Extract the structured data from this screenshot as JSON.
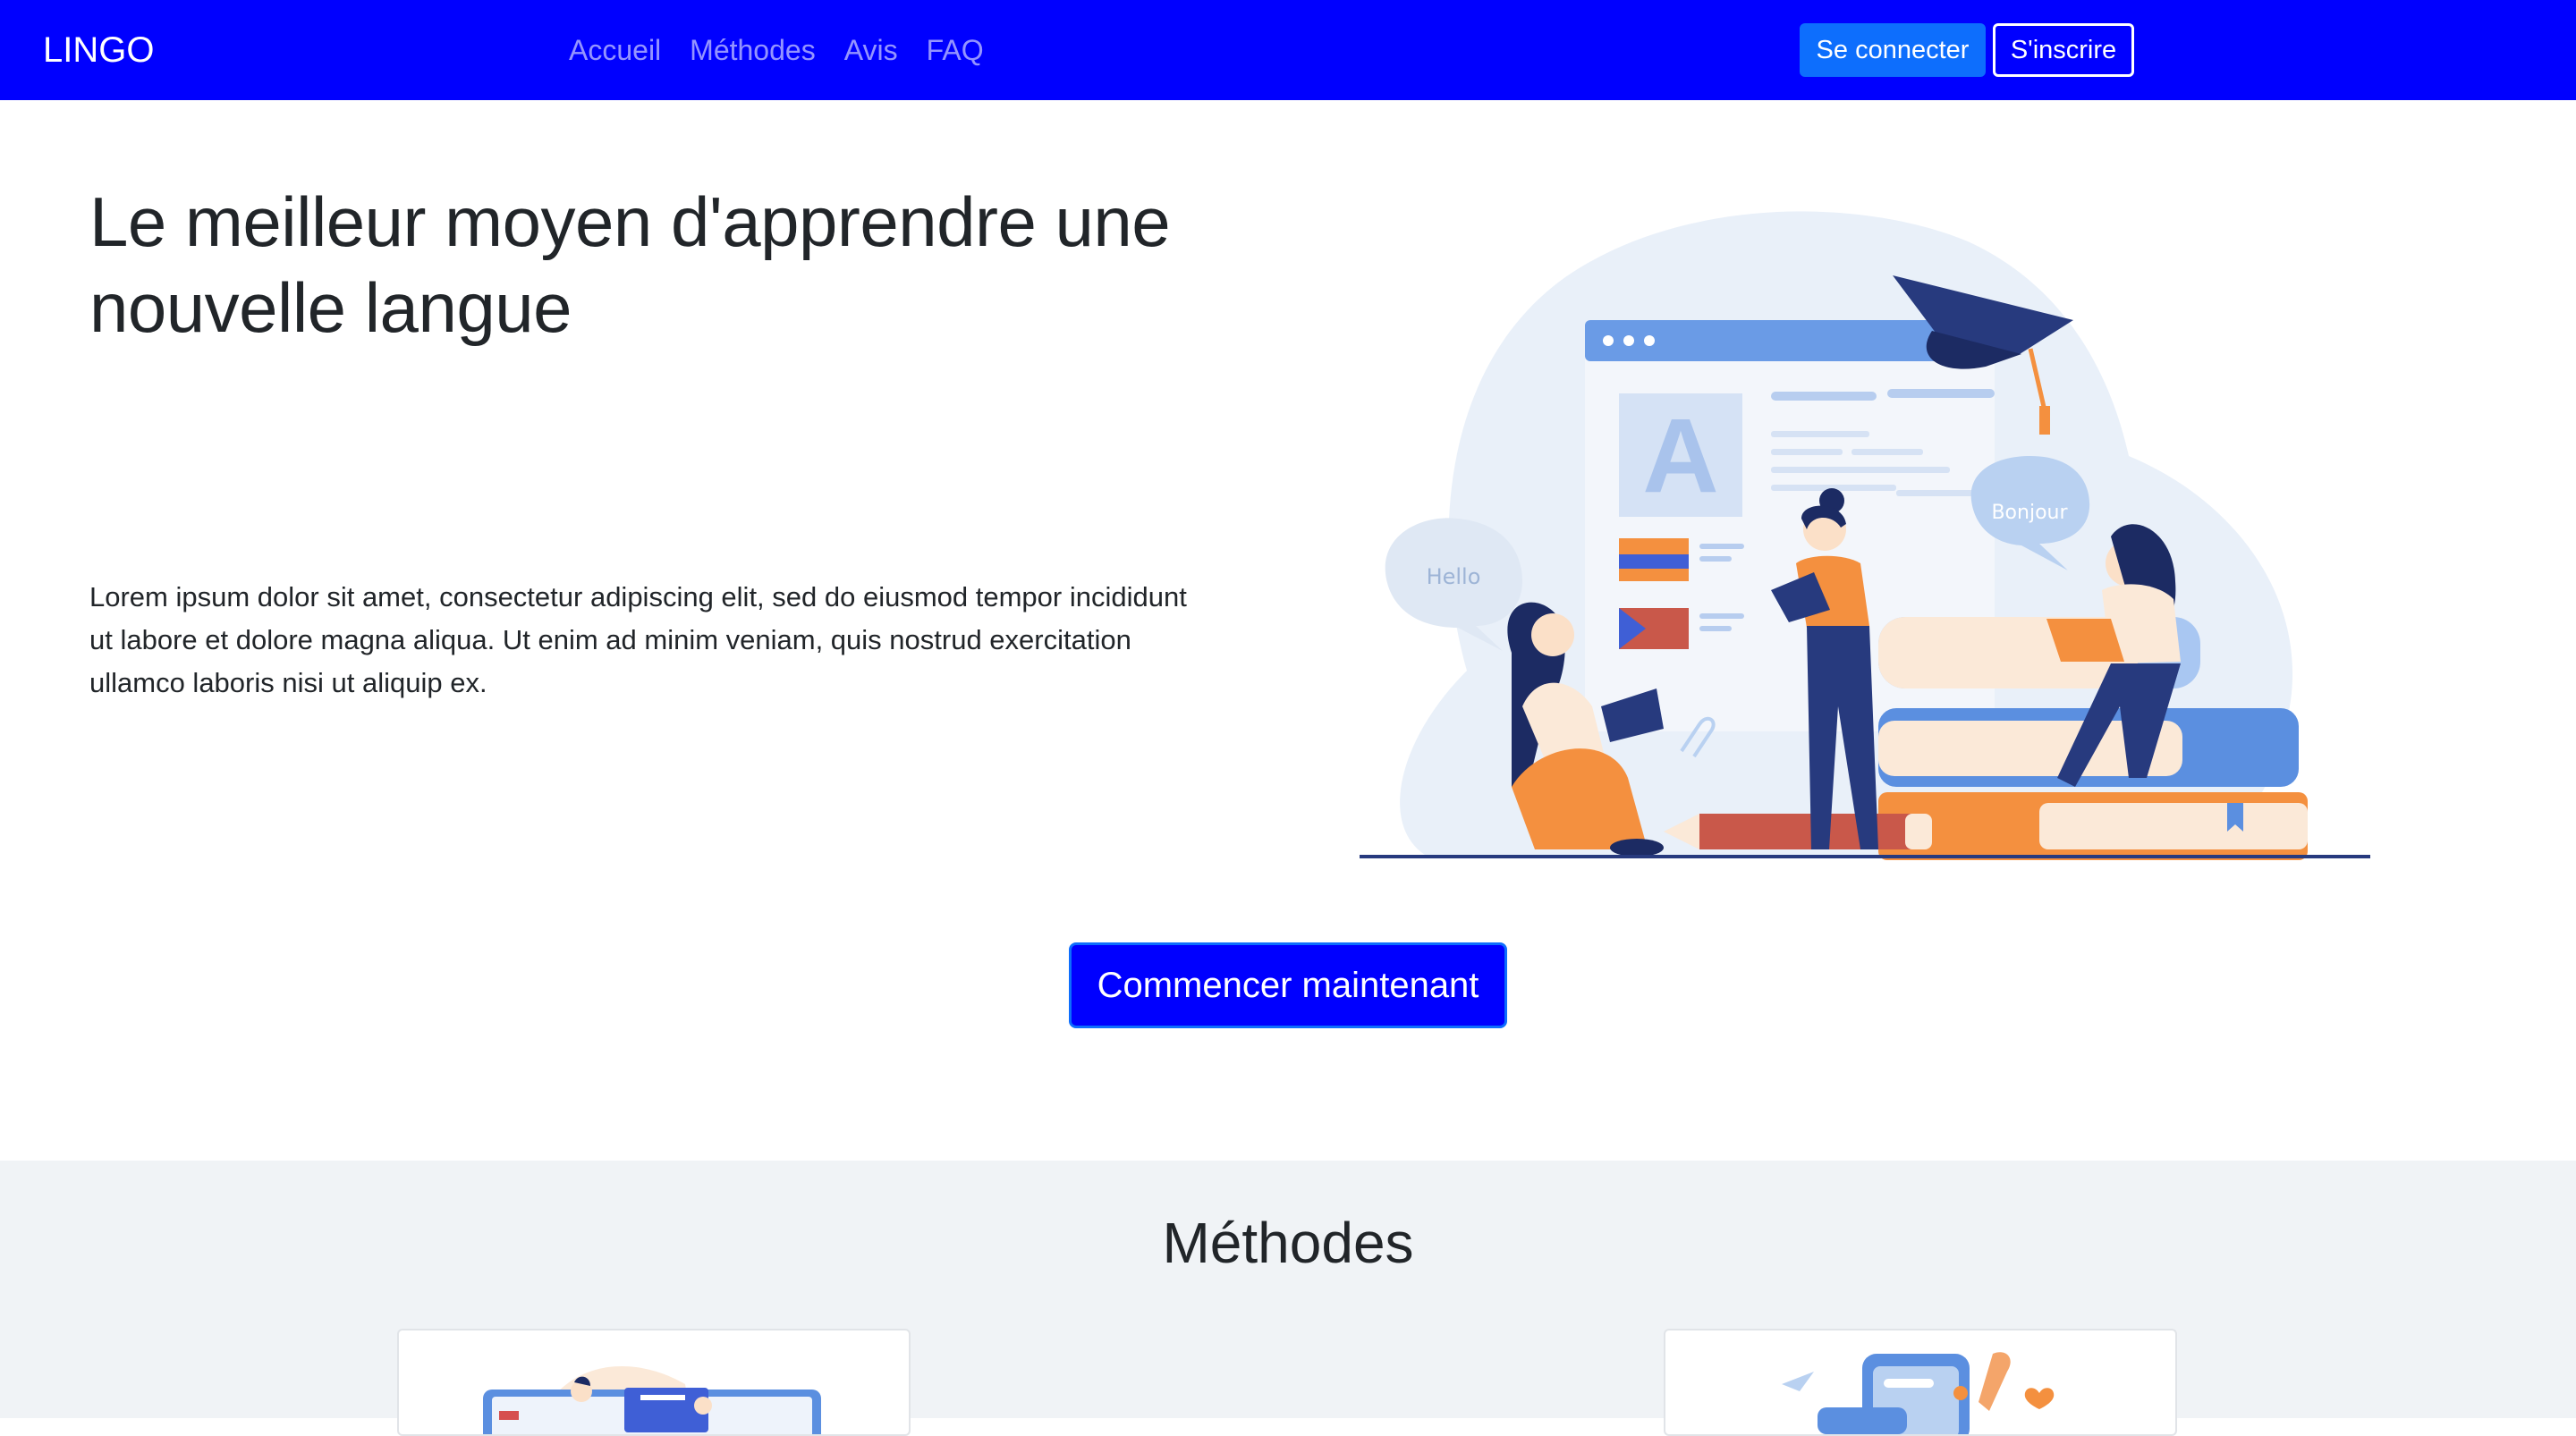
{
  "navbar": {
    "brand": "LINGO",
    "links": [
      "Accueil",
      "Méthodes",
      "Avis",
      "FAQ"
    ],
    "login_label": "Se connecter",
    "signup_label": "S'inscrire",
    "background_color": "#0000ff"
  },
  "hero": {
    "title": "Le meilleur moyen d'apprendre une nouvelle langue",
    "text": "Lorem ipsum dolor sit amet, consectetur adipiscing elit, sed do eiusmod tempor incididunt ut labore et dolore magna aliqua. Ut enim ad minim veniam, quis nostrud exercitation ullamco laboris nisi ut aliquip ex.",
    "illustration": {
      "bubble_left": "Hello",
      "bubble_right": "Bonjour",
      "page_letter": "A"
    },
    "cta_label": "Commencer maintenant"
  },
  "methods": {
    "title": "Méthodes",
    "background_color": "#f0f3f6"
  }
}
